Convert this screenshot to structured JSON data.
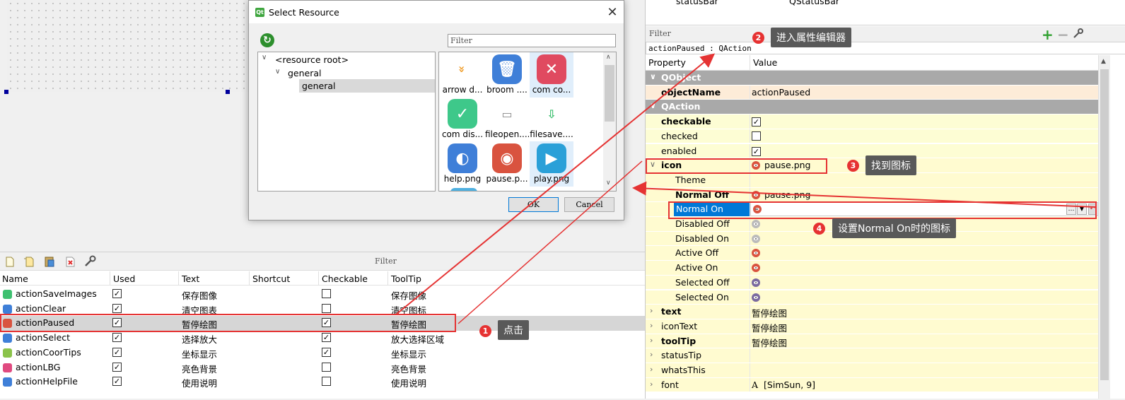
{
  "dialog": {
    "title": "Select Resource",
    "filter_placeholder": "Filter",
    "tree": [
      "<resource root>",
      "general",
      "general"
    ],
    "resources": [
      {
        "label": "arrow d...",
        "icon": "arrow-down-icon",
        "color": "#f0a030"
      },
      {
        "label": "broom ....",
        "icon": "trash-icon",
        "color": "#3f7fd8"
      },
      {
        "label": "com co...",
        "icon": "close-icon",
        "color": "#e04a60"
      },
      {
        "label": "com dis...",
        "icon": "check-icon",
        "color": "#3ec88a"
      },
      {
        "label": "fileopen....",
        "icon": "folder-icon",
        "color": "#888888"
      },
      {
        "label": "filesave....",
        "icon": "save-icon",
        "color": "#3ec070"
      },
      {
        "label": "help.png",
        "icon": "globe-icon",
        "color": "#3f7fd8"
      },
      {
        "label": "pause.p...",
        "icon": "eye-icon",
        "color": "#d9533f"
      },
      {
        "label": "play.png",
        "icon": "play-icon",
        "color": "#2aa0d8"
      }
    ],
    "ok_label": "OK",
    "cancel_label": "Cancel"
  },
  "action_editor": {
    "filter_label": "Filter",
    "columns": [
      "Name",
      "Used",
      "Text",
      "Shortcut",
      "Checkable",
      "ToolTip"
    ],
    "rows": [
      {
        "name": "actionSaveImages",
        "used": true,
        "text": "保存图像",
        "shortcut": "",
        "checkable": false,
        "tooltip": "保存图像",
        "icon_color": "#3ec070"
      },
      {
        "name": "actionClear",
        "used": true,
        "text": "清空图表",
        "shortcut": "",
        "checkable": false,
        "tooltip": "清空图标",
        "icon_color": "#3f7fd8"
      },
      {
        "name": "actionPaused",
        "used": true,
        "text": "暂停绘图",
        "shortcut": "",
        "checkable": true,
        "tooltip": "暂停绘图",
        "icon_color": "#d9533f"
      },
      {
        "name": "actionSelect",
        "used": true,
        "text": "选择放大",
        "shortcut": "",
        "checkable": true,
        "tooltip": "放大选择区域",
        "icon_color": "#3f7fd8"
      },
      {
        "name": "actionCoorTips",
        "used": true,
        "text": "坐标显示",
        "shortcut": "",
        "checkable": true,
        "tooltip": "坐标显示",
        "icon_color": "#8bc34a"
      },
      {
        "name": "actionLBG",
        "used": true,
        "text": "亮色背景",
        "shortcut": "",
        "checkable": false,
        "tooltip": "亮色背景",
        "icon_color": "#e04a80"
      },
      {
        "name": "actionHelpFile",
        "used": true,
        "text": "使用说明",
        "shortcut": "",
        "checkable": false,
        "tooltip": "使用说明",
        "icon_color": "#3f7fd8"
      }
    ]
  },
  "property_editor": {
    "top_row": {
      "name": "statusBar",
      "value": "QStatusBar"
    },
    "filter_label": "Filter",
    "object_label": "actionPaused : QAction",
    "header_property": "Property",
    "header_value": "Value",
    "rows": [
      {
        "name": "QObject",
        "value": "",
        "kind": "group"
      },
      {
        "name": "objectName",
        "value": "actionPaused",
        "kind": "peach",
        "bold": true
      },
      {
        "name": "QAction",
        "value": "",
        "kind": "group"
      },
      {
        "name": "checkable",
        "value": "",
        "kind": "yel",
        "bold": true,
        "check": true
      },
      {
        "name": "checked",
        "value": "",
        "kind": "yel",
        "check": false
      },
      {
        "name": "enabled",
        "value": "",
        "kind": "yel",
        "check": true
      },
      {
        "name": "icon",
        "value": "pause.png",
        "kind": "yel2",
        "bold": true,
        "eye": "#d9533f",
        "expand": "open"
      },
      {
        "name": "Theme",
        "value": "",
        "kind": "yel2",
        "indent": 1
      },
      {
        "name": "Normal Off",
        "value": "pause.png",
        "kind": "yel2",
        "indent": 1,
        "bold": true,
        "eye": "#d9533f"
      },
      {
        "name": "Normal On",
        "value": "",
        "kind": "selected",
        "indent": 1,
        "eye": "#d9533f"
      },
      {
        "name": "Disabled Off",
        "value": "",
        "kind": "yel2",
        "indent": 1,
        "eye": "#bbbbbb"
      },
      {
        "name": "Disabled On",
        "value": "",
        "kind": "yel2",
        "indent": 1,
        "eye": "#bbbbbb"
      },
      {
        "name": "Active Off",
        "value": "",
        "kind": "yel2",
        "indent": 1,
        "eye": "#d9533f"
      },
      {
        "name": "Active On",
        "value": "",
        "kind": "yel2",
        "indent": 1,
        "eye": "#d9533f"
      },
      {
        "name": "Selected Off",
        "value": "",
        "kind": "yel2",
        "indent": 1,
        "eye": "#7a6aa0"
      },
      {
        "name": "Selected On",
        "value": "",
        "kind": "yel2",
        "indent": 1,
        "eye": "#7a6aa0"
      },
      {
        "name": "text",
        "value": "暂停绘图",
        "kind": "yel2",
        "bold": true,
        "expand": "closed"
      },
      {
        "name": "iconText",
        "value": "暂停绘图",
        "kind": "yel2",
        "expand": "closed"
      },
      {
        "name": "toolTip",
        "value": "暂停绘图",
        "kind": "yel2",
        "bold": true,
        "expand": "closed"
      },
      {
        "name": "statusTip",
        "value": "",
        "kind": "yel2",
        "expand": "closed"
      },
      {
        "name": "whatsThis",
        "value": "",
        "kind": "yel2",
        "expand": "closed"
      },
      {
        "name": "font",
        "value": "[SimSun, 9]",
        "kind": "yel2",
        "expand": "closed",
        "font_glyph": "A"
      }
    ]
  },
  "callouts": {
    "c1": {
      "num": "1",
      "text": "点击"
    },
    "c2": {
      "num": "2",
      "text": "进入属性编辑器"
    },
    "c3": {
      "num": "3",
      "text": "找到图标"
    },
    "c4": {
      "num": "4",
      "text": "设置Normal On时的图标"
    }
  },
  "colors": {
    "accent_red": "#e53333",
    "callout_bg": "#595959",
    "selection_blue": "#0078d7"
  }
}
